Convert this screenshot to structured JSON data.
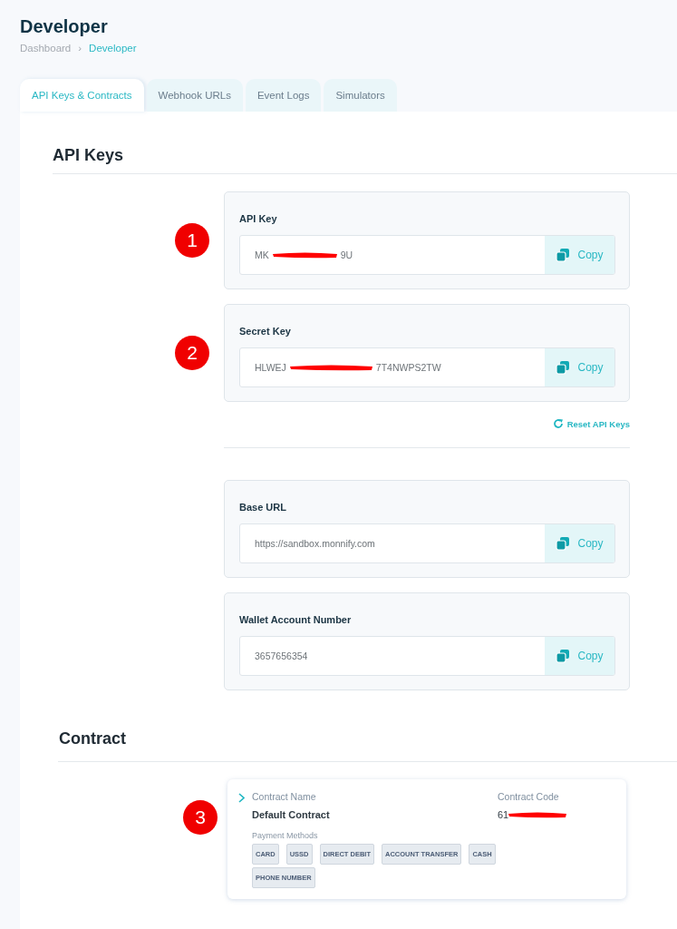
{
  "page": {
    "title": "Developer",
    "breadcrumb_separator": "›",
    "breadcrumb": [
      {
        "label": "Dashboard",
        "current": false
      },
      {
        "label": "Developer",
        "current": true
      }
    ]
  },
  "tabs": [
    {
      "label": "API Keys & Contracts",
      "selected": true
    },
    {
      "label": "Webhook URLs",
      "selected": false
    },
    {
      "label": "Event Logs",
      "selected": false
    },
    {
      "label": "Simulators",
      "selected": false
    }
  ],
  "api_keys": {
    "heading": "API Keys",
    "cards": [
      {
        "label": "API Key",
        "value_start": "MK",
        "value_end": "9U",
        "redacted": true,
        "button": "Copy",
        "annotation": "1"
      },
      {
        "label": "Secret Key",
        "value_start": "HLWEJ",
        "value_end": "7T4NWPS2TW",
        "redacted": true,
        "button": "Copy",
        "annotation": "2"
      }
    ],
    "reset_link": "Reset API Keys",
    "more_cards": [
      {
        "label": "Base URL",
        "value_start": "https://sandbox.monnify.com",
        "redacted": false,
        "button": "Copy"
      },
      {
        "label": "Wallet Account Number",
        "value_start": "3657656354",
        "redacted": false,
        "button": "Copy"
      }
    ]
  },
  "contract": {
    "heading": "Contract",
    "annotation": "3",
    "name_label": "Contract Name",
    "name": "Default Contract",
    "code_label": "Contract Code",
    "code_start": "61",
    "code_redacted": true,
    "methods_label": "Payment Methods",
    "methods": [
      "CARD",
      "USSD",
      "DIRECT DEBIT",
      "ACCOUNT TRANSFER",
      "CASH",
      "PHONE NUMBER"
    ]
  }
}
